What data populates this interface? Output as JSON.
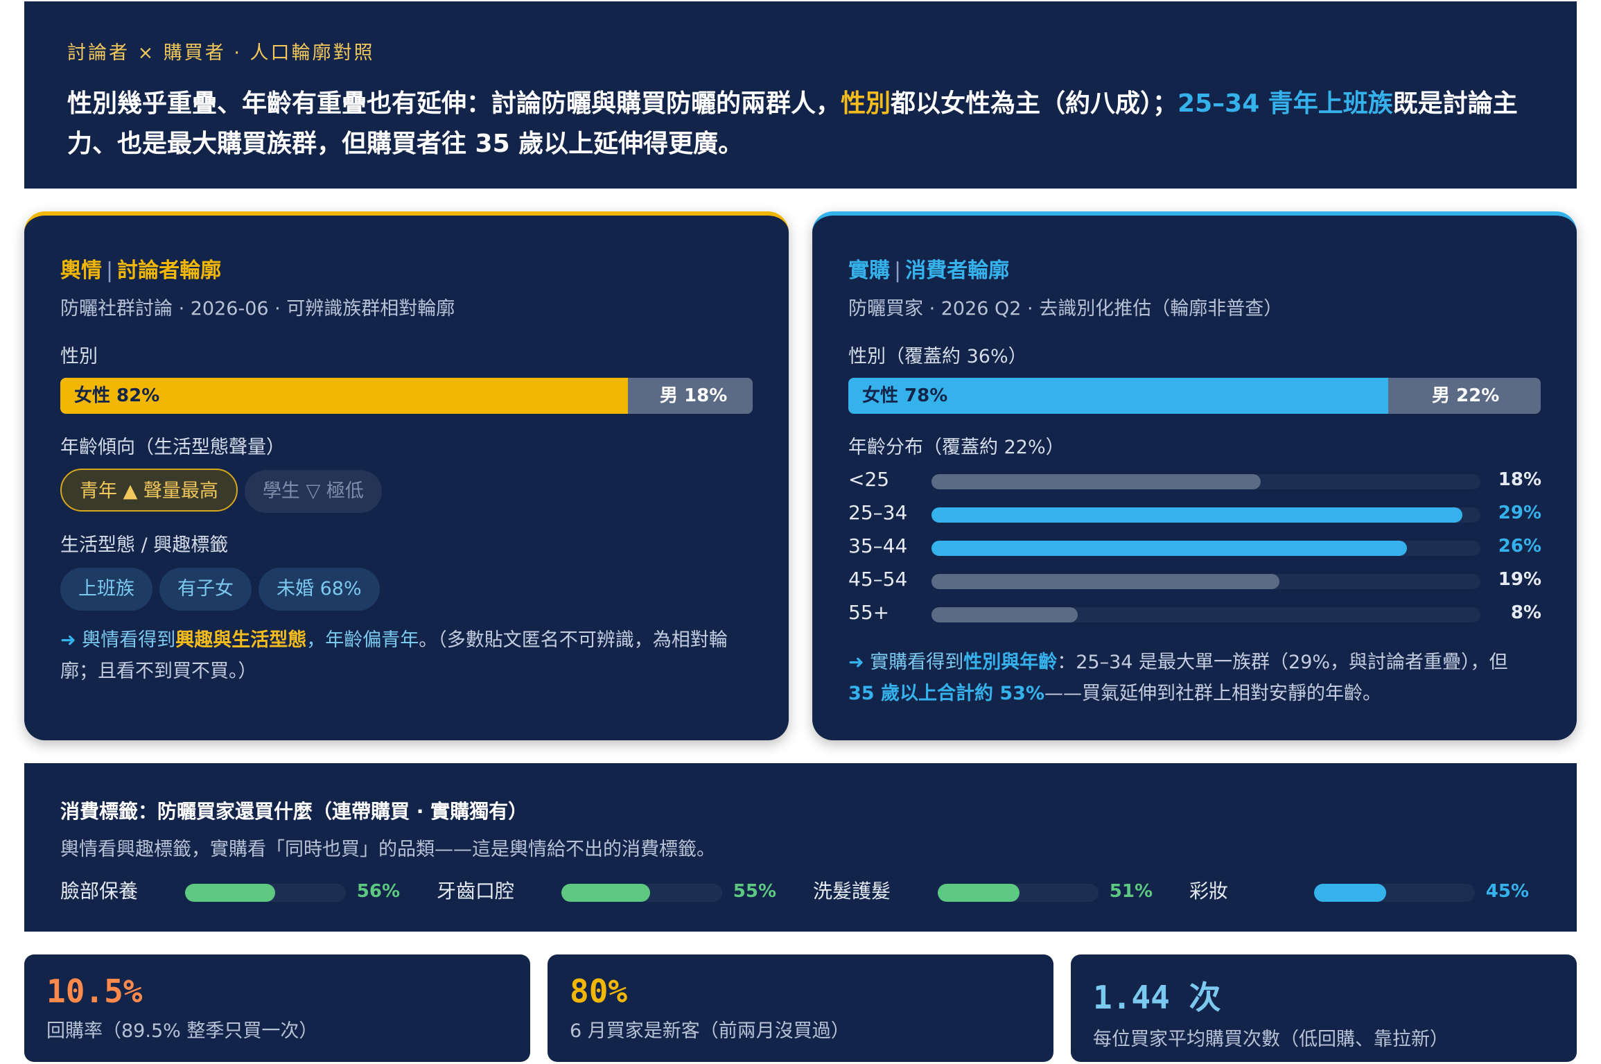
{
  "header": {
    "kicker": "討論者 × 購買者 · 人口輪廓對照",
    "headline_p1": "性別幾乎重疊、年齡有重疊也有延伸：討論防曬與購買防曬的兩群人，",
    "headline_hl1": "性別",
    "headline_p2": "都以女性為主（約八成）；",
    "headline_hl2": "25–34 青年上班族",
    "headline_p3": "既是討論主力、也是最大購買族群，但購買者往 35 歲以上延伸得更廣。"
  },
  "colors": {
    "navy": "#13244a",
    "gold": "#f2b705",
    "blue": "#35b2ec",
    "green": "#5dc882",
    "gray_bar": "#5b6b86",
    "orange": "#ff8a4c"
  },
  "left_card": {
    "title_a": "輿情",
    "title_sep": "|",
    "title_b": "討論者輪廓",
    "subtitle": "防曬社群討論 · 2026-06 · 可辨識族群相對輪廓",
    "gender_label": "性別",
    "female_label": "女性 82%",
    "male_label": "男 18%",
    "age_label": "年齡傾向（生活型態聲量）",
    "age_pill_high": "青年 ▲ 聲量最高",
    "age_pill_low": "學生 ▽ 極低",
    "lifestyle_label": "生活型態 / 興趣標籤",
    "tags": [
      "上班族",
      "有子女",
      "未婚 68%"
    ],
    "note_arrow": "➜",
    "note_p1": "輿情看得到",
    "note_hl": "興趣與生活型態",
    "note_p2": "，年齡偏青年",
    "note_p3": "。（多數貼文匿名不可辨識，為相對輪廓；且看不到買不買。）"
  },
  "right_card": {
    "title_a": "實購",
    "title_sep": "|",
    "title_b": "消費者輪廓",
    "subtitle": "防曬買家 · 2026 Q2 · 去識別化推估（輪廓非普查）",
    "gender_label": "性別（覆蓋約 36%）",
    "female_label": "女性 78%",
    "male_label": "男 22%",
    "age_label": "年齡分布（覆蓋約 22%）",
    "note_arrow": "➜",
    "note_p1": "實購看得到",
    "note_hl1": "性別與年齡",
    "note_p2": "：25–34 是最大單一族群（29%，與討論者重疊），但",
    "note_hl2": "35 歲以上合計約 53%",
    "note_p3": "——買氣延伸到社群上相對安靜的年齡。"
  },
  "chart_data": [
    {
      "type": "bar",
      "title": "性別",
      "categories": [
        "女性",
        "男"
      ],
      "values": [
        82,
        18
      ],
      "unit": "%",
      "orientation": "stacked-horizontal"
    },
    {
      "type": "bar",
      "title": "性別（覆蓋約 36%）",
      "categories": [
        "女性",
        "男"
      ],
      "values": [
        78,
        22
      ],
      "unit": "%",
      "orientation": "stacked-horizontal"
    },
    {
      "type": "bar",
      "title": "年齡分布（覆蓋約 22%）",
      "categories": [
        "<25",
        "25–34",
        "35–44",
        "45–54",
        "55+"
      ],
      "values": [
        18,
        29,
        26,
        19,
        8
      ],
      "labels": [
        "18%",
        "29%",
        "26%",
        "19%",
        "8%"
      ],
      "highlight": [
        false,
        true,
        true,
        false,
        false
      ],
      "xlim": [
        0,
        30
      ],
      "orientation": "horizontal"
    },
    {
      "type": "bar",
      "title": "消費標籤：防曬買家還買什麼（連帶購買 · 實購獨有）",
      "categories": [
        "臉部保養",
        "牙齒口腔",
        "洗髮護髮",
        "彩妝"
      ],
      "values": [
        56,
        55,
        51,
        45
      ],
      "labels": [
        "56%",
        "55%",
        "51%",
        "45%"
      ],
      "bar_colors": [
        "#5dc882",
        "#5dc882",
        "#5dc882",
        "#35b2ec"
      ],
      "xlim": [
        0,
        100
      ],
      "orientation": "horizontal"
    }
  ],
  "consume": {
    "title": "消費標籤：防曬買家還買什麼（連帶購買 · 實購獨有）",
    "subtitle": "輿情看興趣標籤，實購看「同時也買」的品類——這是輿情給不出的消費標籤。"
  },
  "kpis": [
    {
      "value": "10.5%",
      "desc": "回購率（89.5% 整季只買一次）",
      "color": "#ff8a4c"
    },
    {
      "value": "80%",
      "desc": "6 月買家是新客（前兩月沒買過）",
      "color": "#f2b705"
    },
    {
      "value": "1.44 次",
      "desc": "每位買家平均購買次數（低回購、靠拉新）",
      "color": "#7cc9f0"
    }
  ]
}
